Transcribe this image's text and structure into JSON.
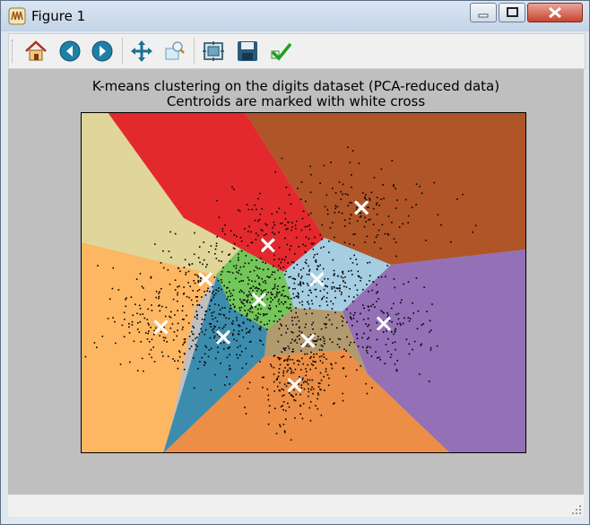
{
  "window": {
    "title": "Figure 1"
  },
  "toolbar": {
    "buttons": [
      {
        "name": "home-icon"
      },
      {
        "name": "back-icon"
      },
      {
        "name": "forward-icon"
      },
      {
        "name": "pan-icon"
      },
      {
        "name": "zoom-icon"
      },
      {
        "name": "subplots-icon"
      },
      {
        "name": "save-icon"
      },
      {
        "name": "edit-icon"
      }
    ]
  },
  "figure": {
    "title_line1": "K-means clustering on the digits dataset (PCA-reduced data)",
    "title_line2": "Centroids are marked with white cross"
  },
  "chart_data": {
    "type": "scatter",
    "title": "K-means clustering on the digits dataset (PCA-reduced data)\nCentroids are marked with white cross",
    "xlabel": "",
    "ylabel": "",
    "ticks": "none",
    "grid": false,
    "n_clusters": 10,
    "region_colors": [
      "#e3292e",
      "#b05528",
      "#e0d69a",
      "#a6cee3",
      "#73c65a",
      "#fdb762",
      "#9470b6",
      "#3c8cad",
      "#b29a6f",
      "#ec8e45"
    ],
    "centroid_marker": "white cross",
    "centroids": [
      {
        "x": 0.63,
        "y": 0.72
      },
      {
        "x": 0.42,
        "y": 0.61
      },
      {
        "x": 0.28,
        "y": 0.51
      },
      {
        "x": 0.53,
        "y": 0.51
      },
      {
        "x": 0.4,
        "y": 0.45
      },
      {
        "x": 0.18,
        "y": 0.37
      },
      {
        "x": 0.68,
        "y": 0.38
      },
      {
        "x": 0.32,
        "y": 0.34
      },
      {
        "x": 0.51,
        "y": 0.33
      },
      {
        "x": 0.48,
        "y": 0.2
      }
    ],
    "colors": {
      "background": "#bfbfbf",
      "points": "#000000",
      "centroid": "#ffffff"
    }
  }
}
